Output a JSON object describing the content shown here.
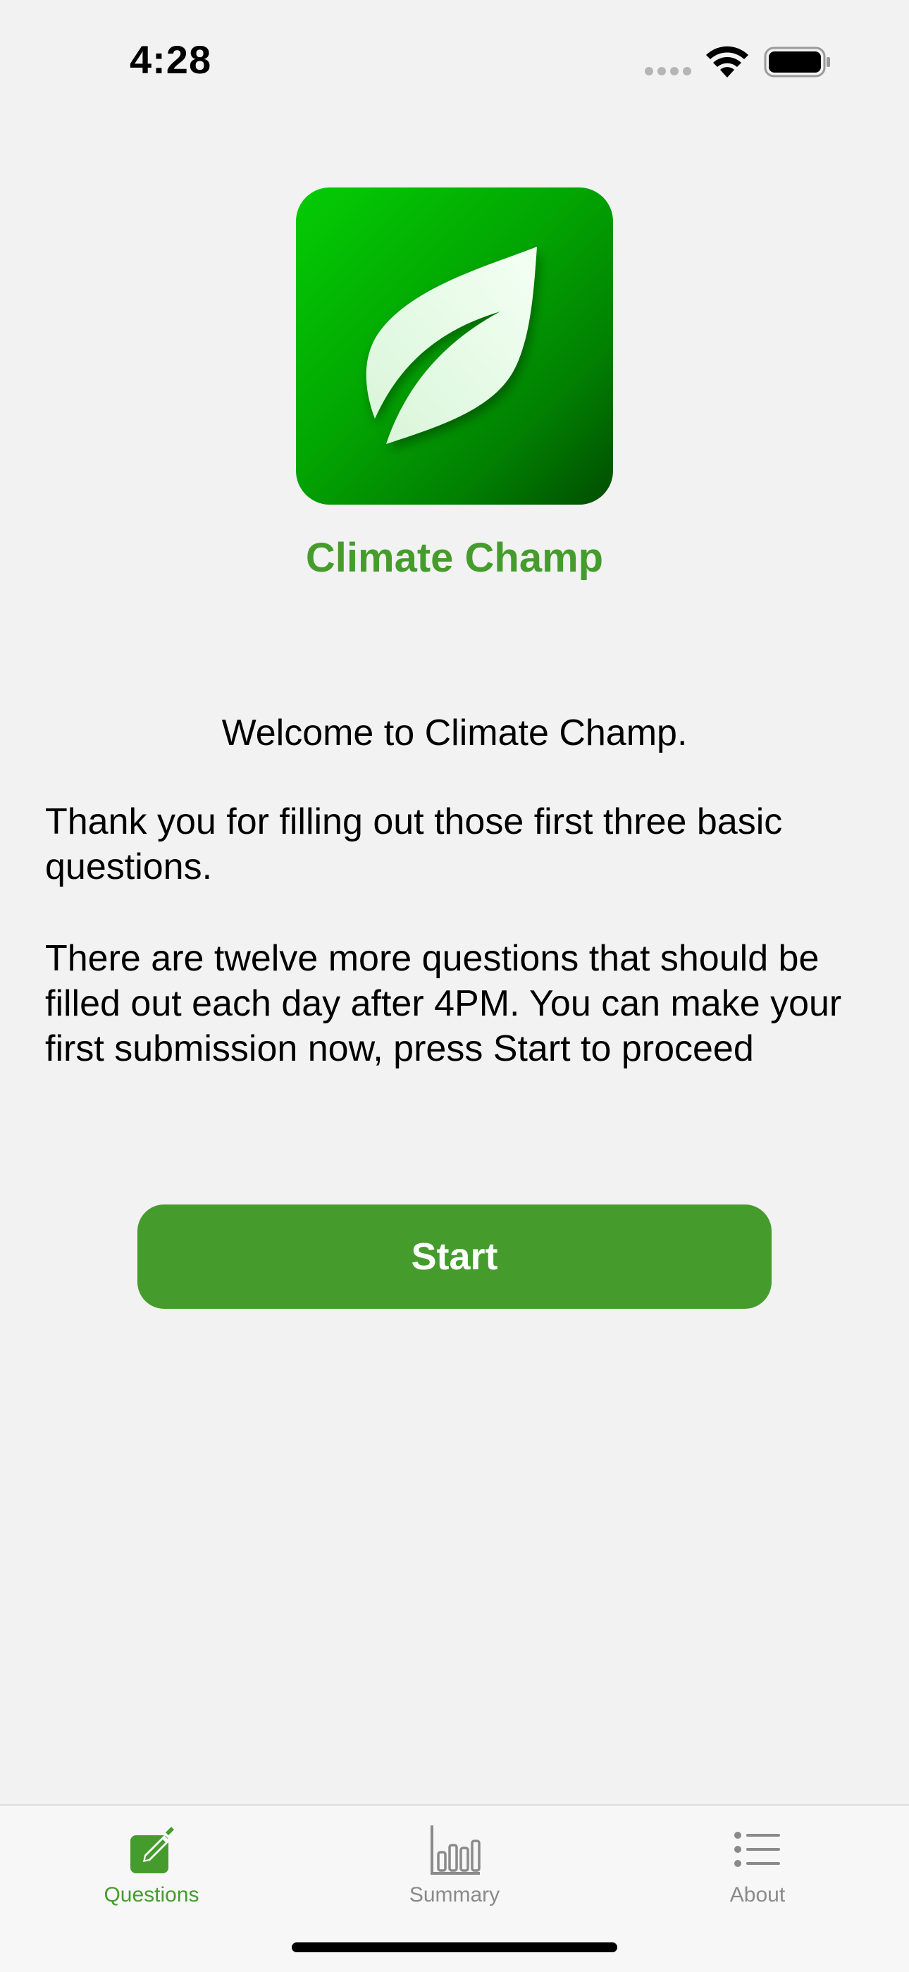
{
  "status_bar": {
    "time": "4:28"
  },
  "app": {
    "title": "Climate Champ",
    "icon": "leaf-icon",
    "accent_color": "#459c2d"
  },
  "main": {
    "welcome": "Welcome to Climate Champ.",
    "paragraph_1": "Thank you for filling out those first three basic questions.",
    "paragraph_2": "There are twelve more questions that should be filled out each day after 4PM. You can make your first submission now, press Start to proceed",
    "start_label": "Start"
  },
  "tab_bar": {
    "tabs": [
      {
        "label": "Questions",
        "icon": "edit-icon",
        "selected": true
      },
      {
        "label": "Summary",
        "icon": "bar-chart-icon",
        "selected": false
      },
      {
        "label": "About",
        "icon": "list-icon",
        "selected": false
      }
    ]
  }
}
